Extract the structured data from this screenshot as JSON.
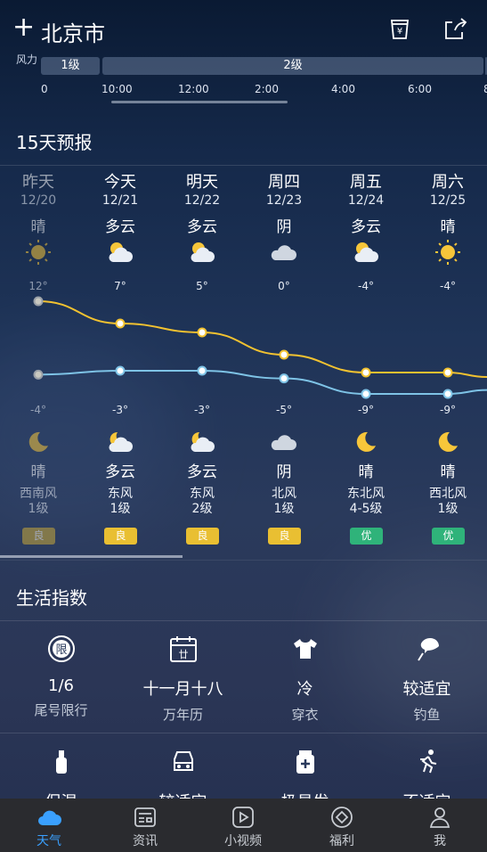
{
  "header": {
    "add": "+",
    "city": "北京市"
  },
  "wind": {
    "label": "风力",
    "segments": [
      "1级",
      "2级"
    ],
    "times": [
      "0",
      "10:00",
      "12:00",
      "2:00",
      "4:00",
      "6:00",
      "8"
    ]
  },
  "forecast": {
    "title": "15天预报",
    "days": [
      {
        "name": "昨天",
        "date": "12/20",
        "day_cond": "晴",
        "day_icon": "sun-icon",
        "high": "12°",
        "low": "-4°",
        "night_icon": "moon-icon",
        "night_cond": "晴",
        "wind_dir": "西南风",
        "wind_lvl": "1级",
        "aqi": "良",
        "aqi_color": "#c9a93a"
      },
      {
        "name": "今天",
        "date": "12/21",
        "day_cond": "多云",
        "day_icon": "partly-cloudy-icon",
        "high": "7°",
        "low": "-3°",
        "night_icon": "partly-cloudy-night-icon",
        "night_cond": "多云",
        "wind_dir": "东风",
        "wind_lvl": "1级",
        "aqi": "良",
        "aqi_color": "#e9bf32"
      },
      {
        "name": "明天",
        "date": "12/22",
        "day_cond": "多云",
        "day_icon": "partly-cloudy-icon",
        "high": "5°",
        "low": "-3°",
        "night_icon": "partly-cloudy-night-icon",
        "night_cond": "多云",
        "wind_dir": "东风",
        "wind_lvl": "2级",
        "aqi": "良",
        "aqi_color": "#e9bf32"
      },
      {
        "name": "周四",
        "date": "12/23",
        "day_cond": "阴",
        "day_icon": "cloud-icon",
        "high": "0°",
        "low": "-5°",
        "night_icon": "cloud-icon",
        "night_cond": "阴",
        "wind_dir": "北风",
        "wind_lvl": "1级",
        "aqi": "良",
        "aqi_color": "#e9bf32"
      },
      {
        "name": "周五",
        "date": "12/24",
        "day_cond": "多云",
        "day_icon": "partly-cloudy-icon",
        "high": "-4°",
        "low": "-9°",
        "night_icon": "moon-icon",
        "night_cond": "晴",
        "wind_dir": "东北风",
        "wind_lvl": "4-5级",
        "aqi": "优",
        "aqi_color": "#2fb37a"
      },
      {
        "name": "周六",
        "date": "12/25",
        "day_cond": "晴",
        "day_icon": "sun-icon",
        "high": "-4°",
        "low": "-9°",
        "night_icon": "moon-icon",
        "night_cond": "晴",
        "wind_dir": "西北风",
        "wind_lvl": "1级",
        "aqi": "优",
        "aqi_color": "#2fb37a"
      }
    ],
    "high_color": "#f2c230",
    "low_color": "#7ec3e6"
  },
  "life": {
    "title": "生活指数",
    "items": [
      {
        "icon": "restriction-icon",
        "value": "1/6",
        "name": "尾号限行"
      },
      {
        "icon": "calendar-icon",
        "value": "十一月十八",
        "name": "万年历"
      },
      {
        "icon": "clothing-icon",
        "value": "冷",
        "name": "穿衣"
      },
      {
        "icon": "fishing-icon",
        "value": "较适宜",
        "name": "钓鱼"
      },
      {
        "icon": "moisturizer-icon",
        "value": "保湿",
        "name": ""
      },
      {
        "icon": "car-icon",
        "value": "较适宜",
        "name": ""
      },
      {
        "icon": "medicine-icon",
        "value": "极易发",
        "name": ""
      },
      {
        "icon": "running-icon",
        "value": "不适宜",
        "name": ""
      }
    ]
  },
  "nav": [
    {
      "icon": "cloud-icon",
      "label": "天气",
      "active": true
    },
    {
      "icon": "news-icon",
      "label": "资讯"
    },
    {
      "icon": "video-icon",
      "label": "小视频"
    },
    {
      "icon": "gift-icon",
      "label": "福利"
    },
    {
      "icon": "profile-icon",
      "label": "我"
    }
  ],
  "colors": {
    "accent": "#3aa0ff",
    "nav_bg": "#2a2b2f"
  }
}
